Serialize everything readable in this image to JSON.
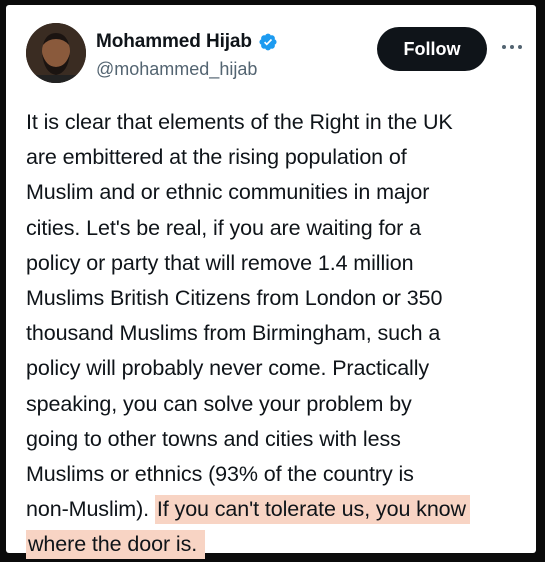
{
  "tweet": {
    "author": {
      "display_name": "Mohammed Hijab",
      "handle": "@mohammed_hijab",
      "verified_icon": "verified-badge-icon",
      "verified_color": "#1d9bf0"
    },
    "follow_label": "Follow",
    "more_icon": "more-options-icon",
    "body_lines": [
      "It is clear that elements of the Right in the UK",
      "are embittered at the rising population of",
      "Muslim and or ethnic communities in major",
      "cities. Let's be real, if you are waiting for a",
      "policy or party that will remove 1.4 million",
      "Muslims British Citizens from London or 350",
      "thousand Muslims from Birmingham, such a",
      "policy will probably never come. Practically",
      "speaking, you can solve your problem by",
      "going to other towns and cities with less",
      "Muslims or ethnics (93% of the country is"
    ],
    "line12_plain": "non-Muslim). ",
    "line12_highlight": "If you can't tolerate us, you know",
    "line13_highlight": "where the door is.",
    "highlight_color": "#f8d4c4"
  }
}
